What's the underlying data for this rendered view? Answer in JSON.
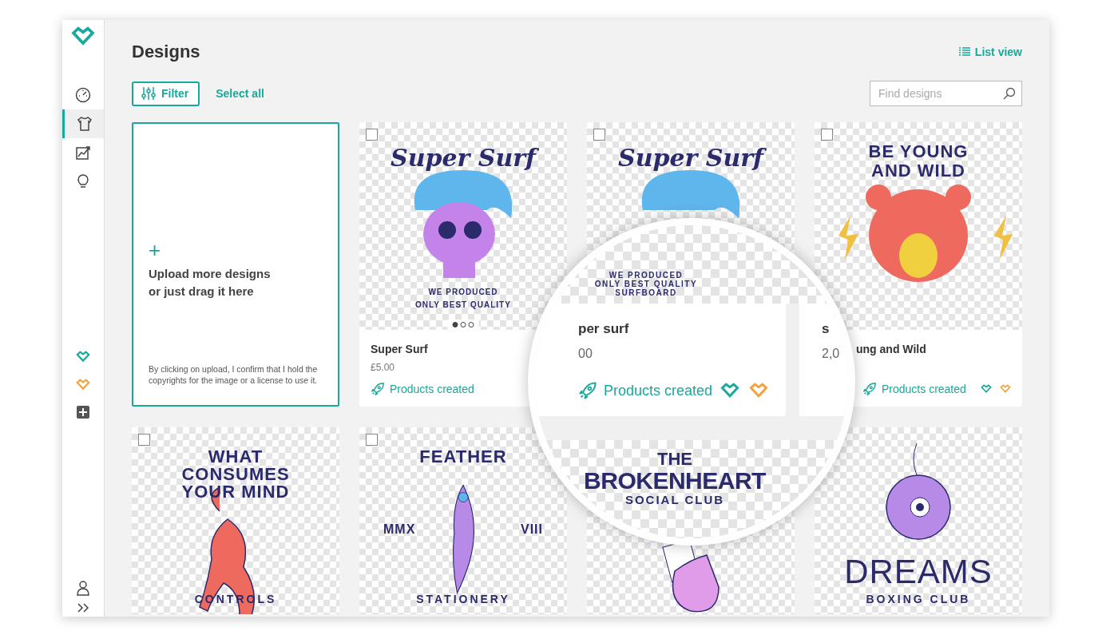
{
  "sidebar": {
    "nav": [
      {
        "selected": false
      },
      {
        "selected": true
      },
      {
        "selected": false
      },
      {
        "selected": false
      }
    ]
  },
  "header": {
    "title": "Designs",
    "list_view": "List view"
  },
  "toolbar": {
    "filter": "Filter",
    "select_all": "Select all",
    "search": {
      "placeholder": "Find designs"
    }
  },
  "upload": {
    "icon": "+",
    "lines": [
      "Upload more designs",
      "or just drag it here"
    ],
    "disclaimer": "By clicking on upload, I confirm that I hold the copyrights for the image or a license to use it."
  },
  "designs": [
    {
      "checked": false,
      "art_top": [
        "Super Surf"
      ],
      "art_bottom": [
        "WE PRODUCED",
        "ONLY BEST QUALITY"
      ],
      "pager": [
        {
          "selected": true
        },
        {
          "selected": false
        },
        {
          "selected": false
        }
      ],
      "title": "Super Surf",
      "price": "£5.00",
      "status": "Products created",
      "marks": false
    },
    {
      "checked": false,
      "art_top": [
        "Super Surf"
      ]
    },
    {
      "checked": false,
      "art_top": [
        "BE YOUNG",
        "AND WILD"
      ],
      "title": "ung and Wild",
      "status": "Products created",
      "marks": true
    },
    {
      "checked": false,
      "art_top": [
        "WHAT CONSUMES YOUR MIND"
      ],
      "art_bottom": [
        "CONTROLS"
      ]
    },
    {
      "checked": false,
      "art_top": [
        "FEATHER"
      ],
      "art_left": [
        "MMX"
      ],
      "art_right": [
        "VIII"
      ],
      "art_bottom": [
        "STATIONERY"
      ]
    },
    {
      "magnified_art": [
        "THE",
        "BROKENHEART",
        "SOCIAL CLUB"
      ]
    },
    {
      "art_bottom": [
        "DREAMS",
        "BOXING CLUB"
      ]
    }
  ],
  "magnifier": {
    "caption": [
      "WE PRODUCED",
      "ONLY BEST QUALITY",
      "SURFBOARD"
    ],
    "title": "per surf",
    "price": "00",
    "status": "Products created",
    "side_title": "s",
    "side_price": "2,0"
  }
}
